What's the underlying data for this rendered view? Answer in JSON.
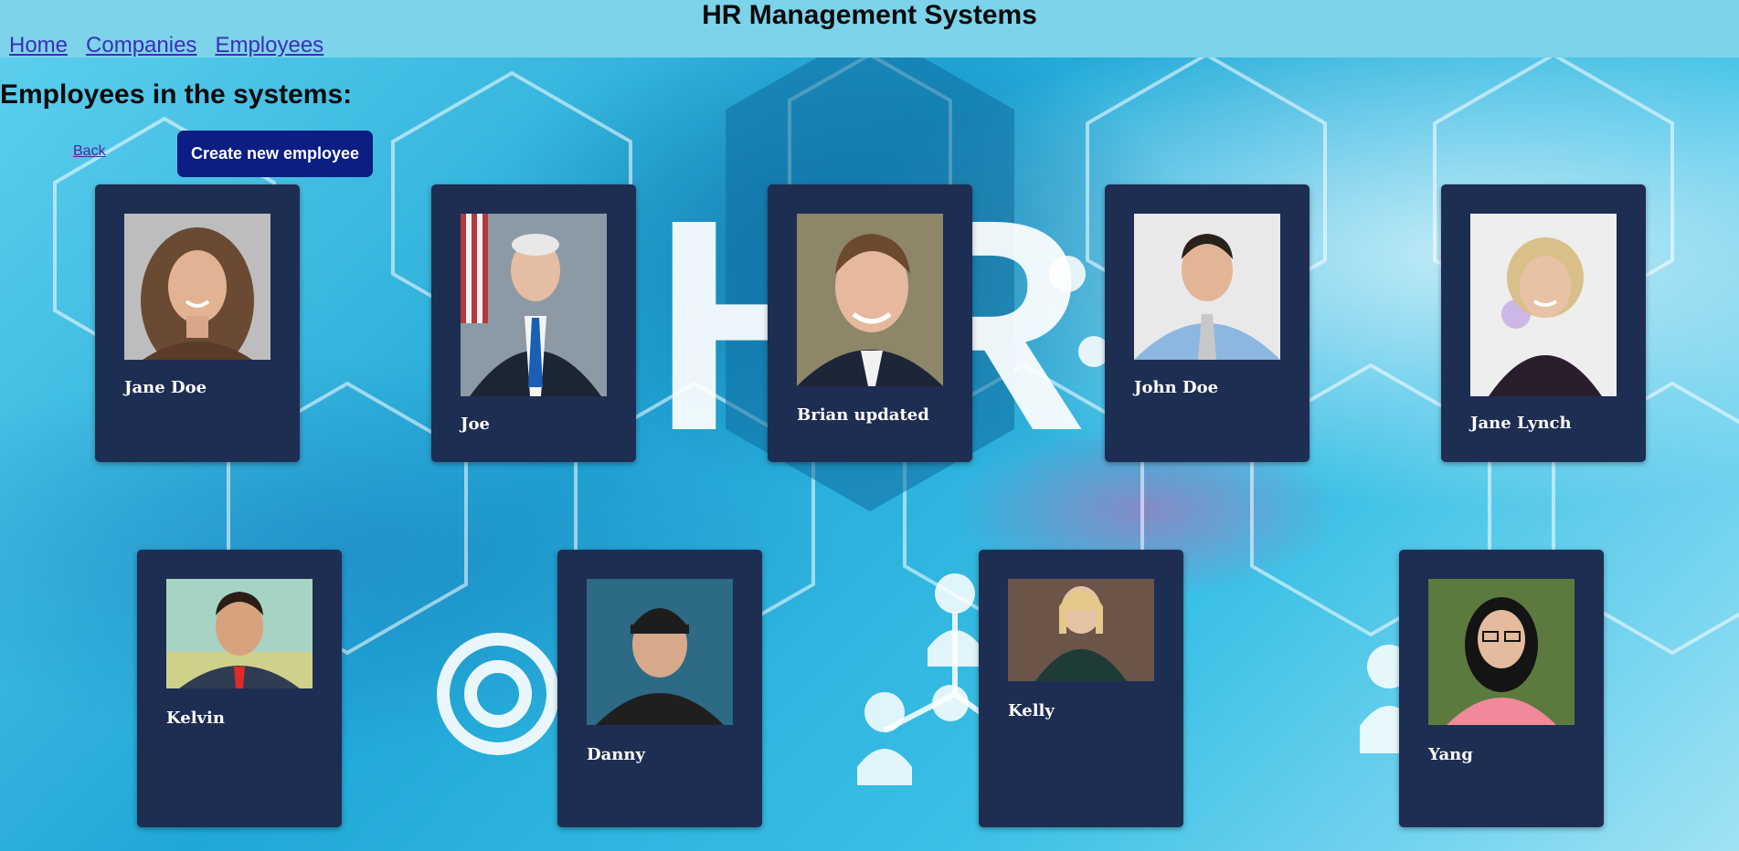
{
  "header": {
    "title": "HR Management Systems",
    "nav": [
      "Home",
      "Companies",
      "Employees"
    ]
  },
  "page": {
    "heading": "Employees in the systems:",
    "back_label": "Back",
    "create_label": "Create new employee"
  },
  "employees": [
    {
      "name": "Jane Doe"
    },
    {
      "name": "Joe"
    },
    {
      "name": "Brian updated"
    },
    {
      "name": "John Doe"
    },
    {
      "name": "Jane Lynch"
    },
    {
      "name": "Kelvin"
    },
    {
      "name": "Danny"
    },
    {
      "name": "Kelly"
    },
    {
      "name": "Yang"
    }
  ],
  "colors": {
    "topbar": "#7cd3ea",
    "card": "#1e2d52",
    "button": "#0c1d83",
    "link": "#3b2fb7"
  }
}
